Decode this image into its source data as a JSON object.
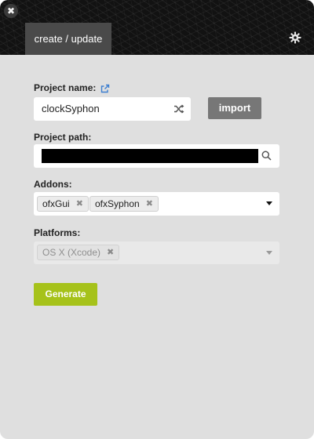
{
  "window": {
    "close_glyph": "✖"
  },
  "tabs": [
    {
      "label": "create / update",
      "active": true
    }
  ],
  "icons": {
    "close": "close-icon",
    "settings": "gear-icon",
    "external_link": "external-link-icon",
    "shuffle": "shuffle-icon",
    "search": "search-icon",
    "dropdown": "chevron-down-icon"
  },
  "project_name": {
    "label": "Project name:",
    "value": "clockSyphon"
  },
  "import_button": {
    "label": "import"
  },
  "project_path": {
    "label": "Project path:"
  },
  "addons": {
    "label": "Addons:",
    "selected": [
      {
        "name": "ofxGui",
        "remove": "✖"
      },
      {
        "name": "ofxSyphon",
        "remove": "✖"
      }
    ]
  },
  "platforms": {
    "label": "Platforms:",
    "selected": [
      {
        "name": "OS X (Xcode)",
        "remove": "✖"
      }
    ]
  },
  "generate_button": {
    "label": "Generate"
  },
  "colors": {
    "header_bg": "#121212",
    "body_bg": "#dfdfdf",
    "tab_active_bg": "#4a4a4a",
    "import_bg": "#777777",
    "generate_bg": "#a6c21a",
    "link_blue": "#3d7fd0"
  }
}
